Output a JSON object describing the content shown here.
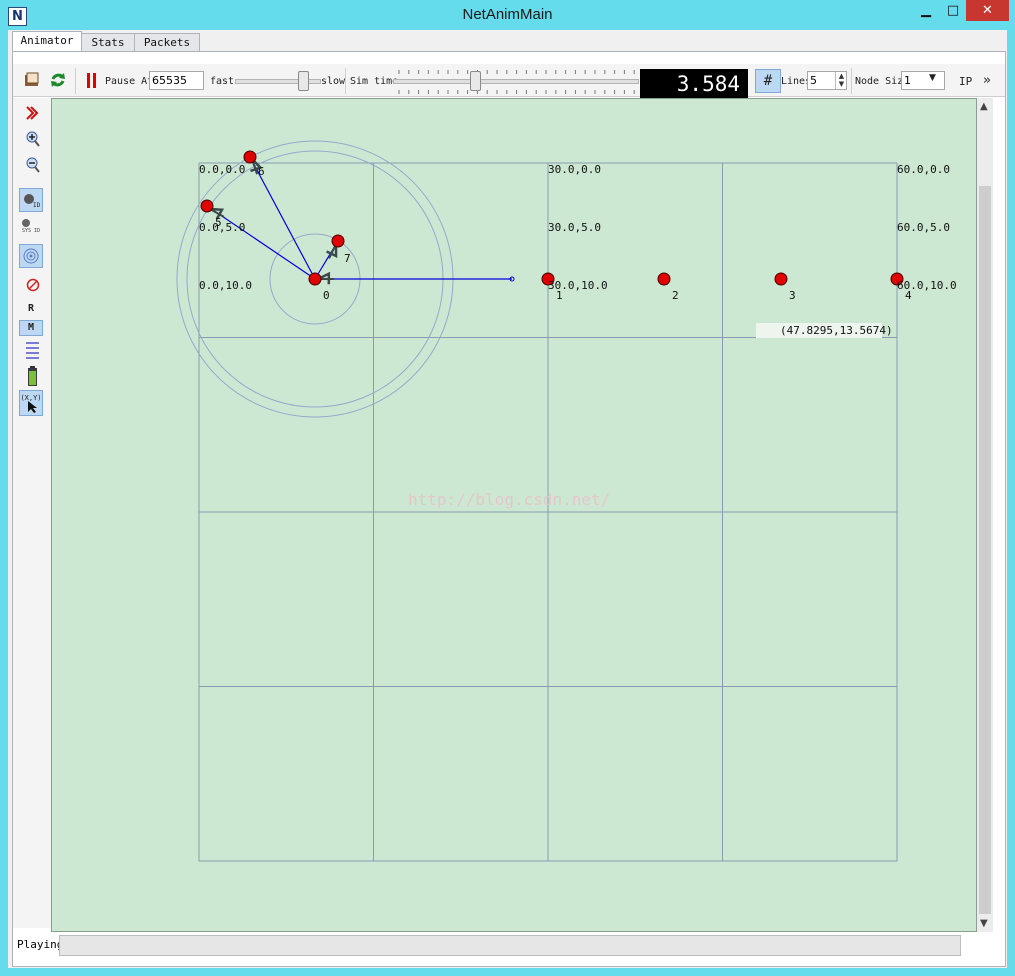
{
  "window": {
    "title": "NetAnimMain",
    "icon_letter": "N",
    "min_glyph": "▁",
    "max_glyph": "□",
    "close_glyph": "✕"
  },
  "tabs": [
    {
      "label": "Animator",
      "active": true
    },
    {
      "label": "Stats"
    },
    {
      "label": "Packets"
    }
  ],
  "toolbar": {
    "pause_label": "Pause At",
    "pause_value": "65535",
    "fast_label": "fast",
    "slow_label": "slow",
    "sim_time_label": "Sim time",
    "sim_time_value": "3.584",
    "lines_label": "Lines",
    "lines_value": "5",
    "node_size_label": "Node Size",
    "node_size_value": "1",
    "ip_label": "IP",
    "more_glyph": "»"
  },
  "sidebar": {
    "r_label": "R",
    "m_label": "M",
    "xy_label": "(X,Y)",
    "id_label": "ID",
    "sys_id_label": "SYS ID"
  },
  "grid_labels": {
    "r0c0": "0.0,0.0",
    "r0c1": "30.0,0.0",
    "r0c2": "60.0,0.0",
    "r1c0": "0.0,5.0",
    "r1c1": "30.0,5.0",
    "r1c2": "60.0,5.0",
    "r2c0": "0.0,10.0",
    "r2c1": "30.0,10.0",
    "r2c2": "60.0,10.0"
  },
  "nodes": [
    {
      "id": "0"
    },
    {
      "id": "1"
    },
    {
      "id": "2"
    },
    {
      "id": "3"
    },
    {
      "id": "4"
    },
    {
      "id": "5"
    },
    {
      "id": "6"
    },
    {
      "id": "7"
    }
  ],
  "mouse_readout": "(47.8295,13.5674)",
  "watermark": "http://blog.csdn.net/",
  "status": {
    "text": "Playing"
  },
  "colors": {
    "canvas": "#cde8d2",
    "grid": "#8a9bb2",
    "node": "#e00000",
    "link": "#0000e0",
    "lcd_bg": "#000000"
  }
}
